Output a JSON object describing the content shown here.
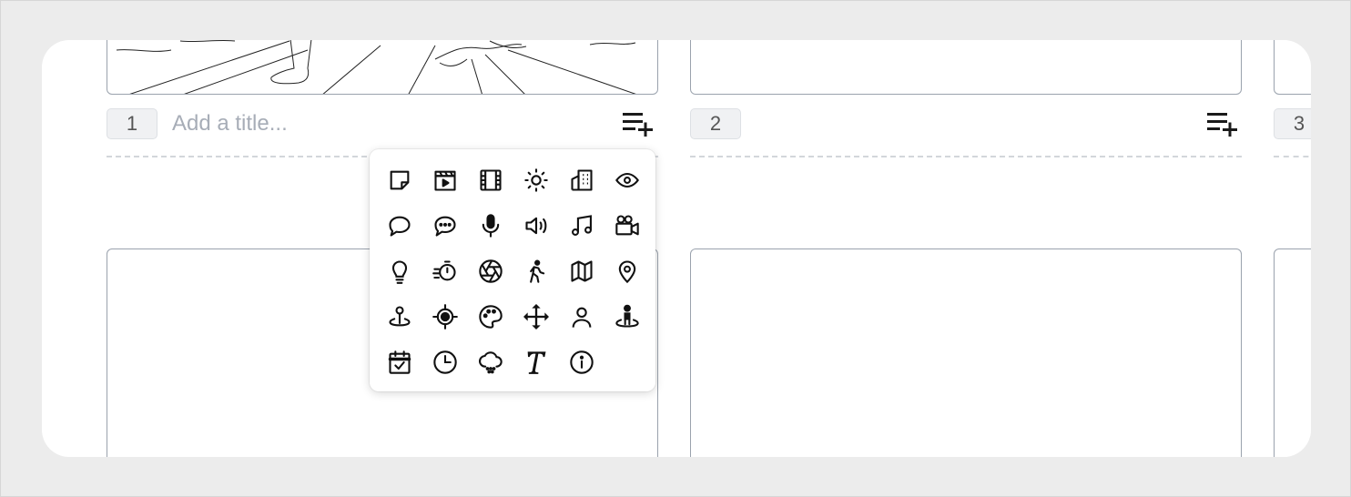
{
  "panels": [
    {
      "number": "1",
      "title_placeholder": "Add a title..."
    },
    {
      "number": "2"
    },
    {
      "number": "3"
    }
  ],
  "icon_picker": {
    "icons": [
      "sticky-note-icon",
      "clapperboard-icon",
      "film-icon",
      "sun-icon",
      "building-icon",
      "eye-icon",
      "speech-bubble-icon",
      "chat-dots-icon",
      "microphone-icon",
      "speaker-icon",
      "music-note-icon",
      "video-camera-icon",
      "lightbulb-icon",
      "stopwatch-icon",
      "aperture-icon",
      "walking-person-icon",
      "map-icon",
      "location-pin-icon",
      "map-pin-anchor-icon",
      "target-icon",
      "palette-icon",
      "move-arrows-icon",
      "person-icon",
      "person-standing-icon",
      "calendar-check-icon",
      "clock-icon",
      "cloud-rain-icon",
      "text-icon",
      "info-icon"
    ]
  }
}
